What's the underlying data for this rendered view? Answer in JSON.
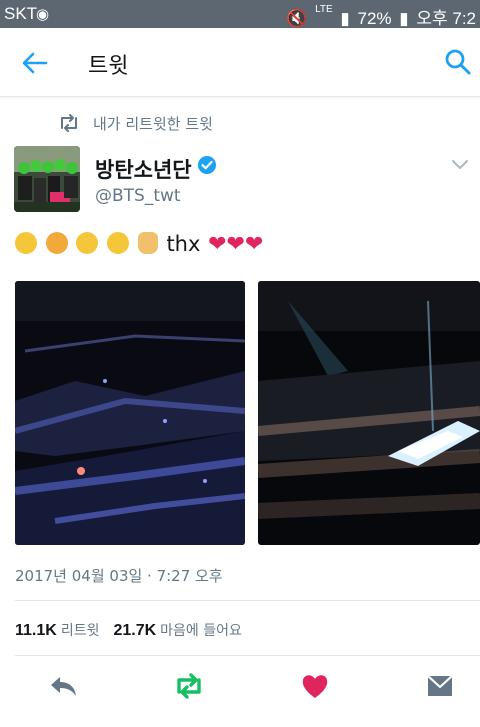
{
  "status_bar": {
    "carrier": "SKT",
    "lte": "LTE",
    "battery": "72%",
    "time": "오후 7:2"
  },
  "app_bar": {
    "title": "트윗"
  },
  "retweet_context": {
    "text": "내가 리트윗한 트윗"
  },
  "tweet": {
    "author_name": "방탄소년단",
    "handle": "@BTS_twt",
    "text": "thx",
    "timestamp": "2017년 04월 03일 · 7:27 오후"
  },
  "stats": {
    "retweets_count": "11.1K",
    "retweets_label": "리트윗",
    "likes_count": "21.7K",
    "likes_label": "마음에 들어요"
  },
  "colors": {
    "status_bar": "#5d6772",
    "accent_blue": "#1da1f2",
    "retweet_green": "#17bf63",
    "like_red": "#e0245e",
    "secondary_text": "#657786"
  },
  "icons": {
    "back": "arrow-left-icon",
    "search": "search-icon",
    "retweet": "retweet-icon",
    "verified": "verified-badge-icon",
    "chevron": "chevron-down-icon",
    "reply": "reply-icon",
    "like": "heart-icon",
    "message": "direct-message-icon"
  }
}
